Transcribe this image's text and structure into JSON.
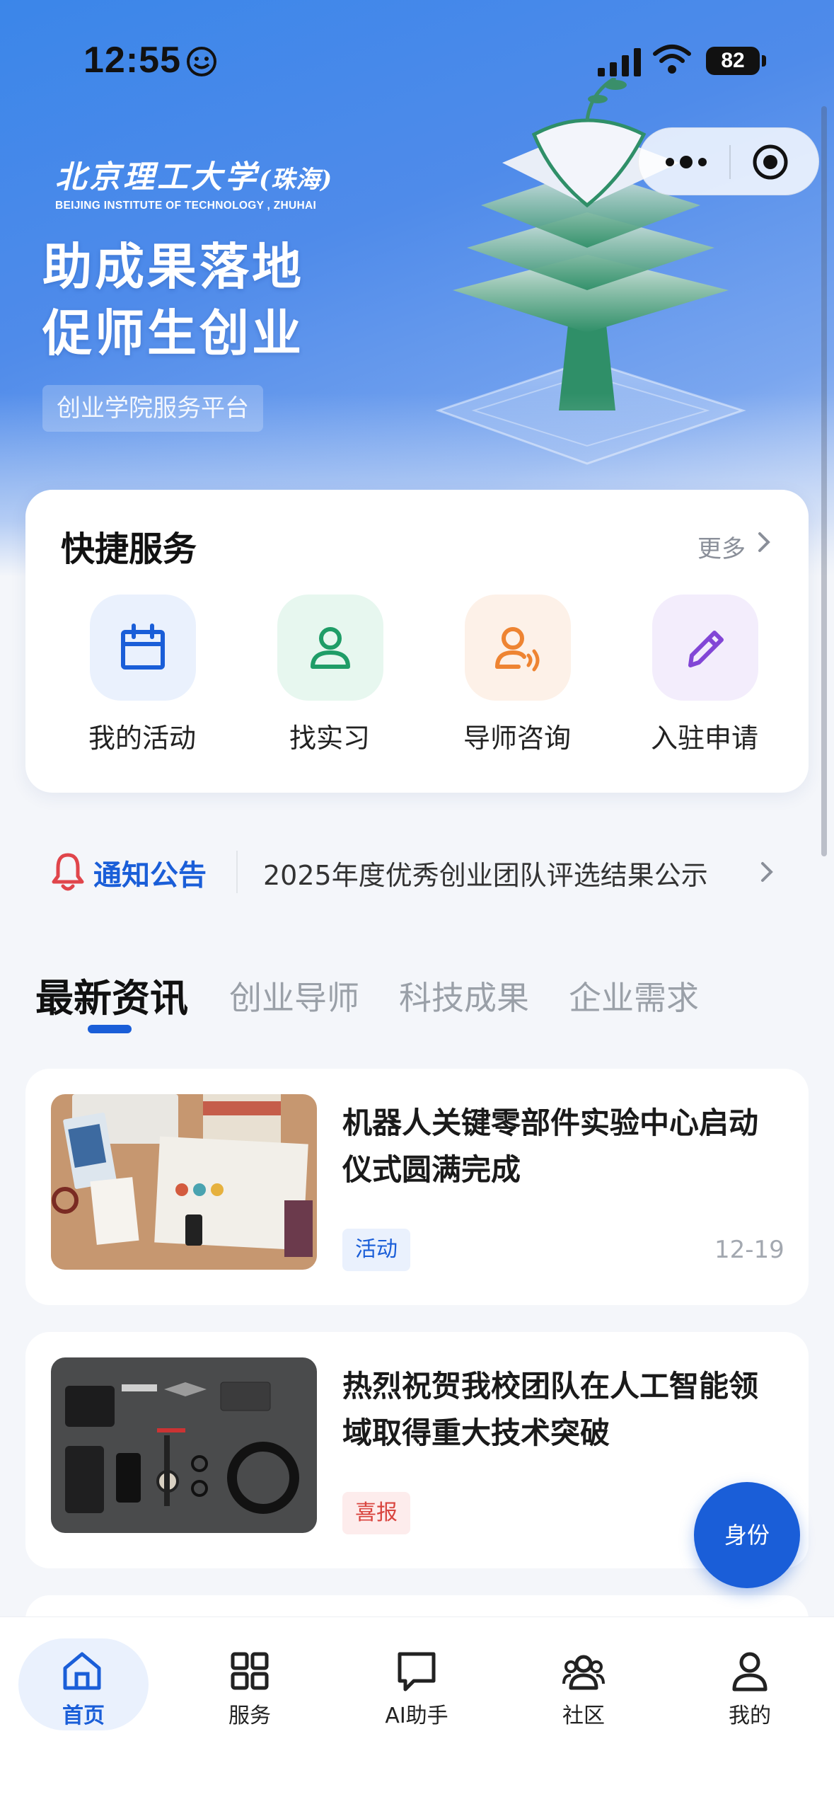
{
  "status_bar": {
    "time": "12:55",
    "battery": "82"
  },
  "hero": {
    "logo_cn": "北京理工大学",
    "logo_cn_suffix": "(珠海)",
    "logo_en": "BEIJING INSTITUTE OF TECHNOLOGY , ZHUHAI",
    "slogan_line1": "助成果落地",
    "slogan_line2": "促师生创业",
    "tag": "创业学院服务平台"
  },
  "quick_services": {
    "title": "快捷服务",
    "more": "更多",
    "items": [
      {
        "label": "我的活动",
        "icon": "calendar-icon",
        "bg": "#eaf1fd",
        "color": "#1a5ed8"
      },
      {
        "label": "找实习",
        "icon": "person-icon",
        "bg": "#e7f7ef",
        "color": "#1f9d67"
      },
      {
        "label": "导师咨询",
        "icon": "mentor-voice-icon",
        "bg": "#fdf1e8",
        "color": "#ee8432"
      },
      {
        "label": "入驻申请",
        "icon": "pencil-icon",
        "bg": "#f3edfc",
        "color": "#8246d6"
      }
    ]
  },
  "notice": {
    "label": "通知公告",
    "text": "2025年度优秀创业团队评选结果公示"
  },
  "tabs": [
    "最新资讯",
    "创业导师",
    "科技成果",
    "企业需求"
  ],
  "news": [
    {
      "title": "机器人关键零部件实验中心启动仪式圆满完成",
      "tag": "活动",
      "date": "12-19"
    },
    {
      "title": "热烈祝贺我校团队在人工智能领域取得重大技术突破",
      "tag": "喜报",
      "date": ""
    }
  ],
  "fab": {
    "label": "身份"
  },
  "bottom_nav": [
    {
      "label": "首页",
      "icon": "home-icon"
    },
    {
      "label": "服务",
      "icon": "grid-icon"
    },
    {
      "label": "AI助手",
      "icon": "chat-icon"
    },
    {
      "label": "社区",
      "icon": "community-icon"
    },
    {
      "label": "我的",
      "icon": "user-icon"
    }
  ],
  "colors": {
    "accent": "#1a5ed8",
    "hero_top": "#3b86e9",
    "page_bg": "#f4f6fa"
  }
}
